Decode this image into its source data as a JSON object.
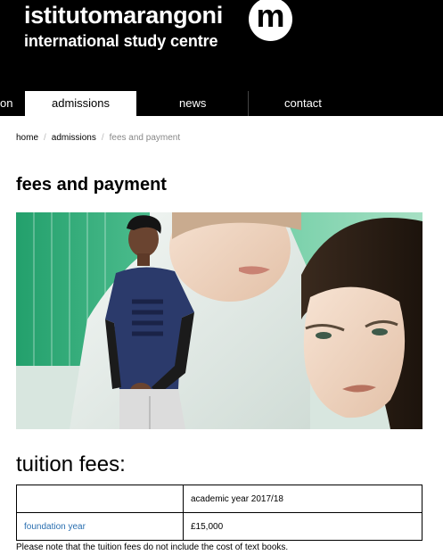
{
  "brand": {
    "name": "istitutomarangoni",
    "subtitle": "international study centre",
    "logo_letter": "m"
  },
  "nav": {
    "items": [
      {
        "label": "on",
        "active": false
      },
      {
        "label": "admissions",
        "active": true
      },
      {
        "label": "news",
        "active": false
      },
      {
        "label": "contact",
        "active": false
      }
    ]
  },
  "breadcrumb": {
    "home": "home",
    "admissions": "admissions",
    "current": "fees and payment",
    "separator": "/"
  },
  "page": {
    "title": "fees and payment"
  },
  "tuition": {
    "heading": "tuition fees:",
    "header_col1": "",
    "header_col2": "academic year 2017/18",
    "rows": [
      {
        "program": "foundation year",
        "fee": "£15,000"
      }
    ],
    "note": "Please note that the tuition fees do not include the cost of text books."
  },
  "colors": {
    "header_bg": "#000000",
    "link": "#2a6fb0",
    "hero_green": "#2f9e78"
  }
}
